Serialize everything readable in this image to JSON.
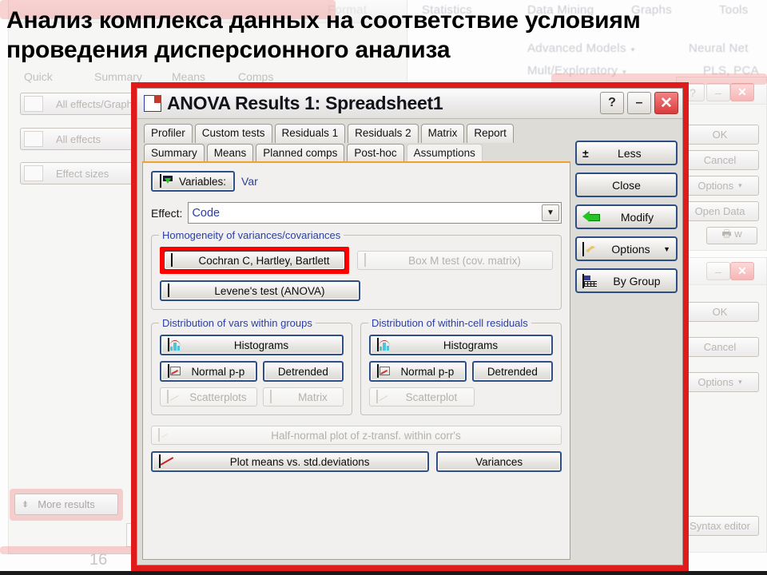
{
  "slide": {
    "title_line1": "Анализ комплекса данных на соответствие условиям",
    "title_line2": "проведения дисперсионного анализа",
    "page_number": "16"
  },
  "background": {
    "ribbon_menus": [
      "Format",
      "Statistics",
      "Data Mining",
      "Graphs",
      "Tools"
    ],
    "ribbon_items": [
      "Advanced Models",
      "Neural Net",
      "Mult/Exploratory",
      "PLS, PCA"
    ],
    "left_window": {
      "tabs": [
        "Quick",
        "Summary",
        "Means",
        "Comps"
      ],
      "buttons": [
        "All effects/Graphs",
        "All effects",
        "Effect sizes"
      ],
      "more_results": "More results"
    },
    "right_window_top": {
      "buttons": [
        "OK",
        "Cancel",
        "Options",
        "Open Data"
      ]
    },
    "right_window_bottom": {
      "buttons": [
        "OK",
        "Cancel",
        "Options",
        "Syntax editor"
      ]
    }
  },
  "dialog": {
    "title": "ANOVA Results 1: Spreadsheet1",
    "caption_buttons": {
      "help": "?",
      "minimize": "–",
      "close": "✕"
    },
    "tabs_row1": [
      "Profiler",
      "Custom tests",
      "Residuals 1",
      "Residuals 2",
      "Matrix",
      "Report"
    ],
    "tabs_row2": [
      "Summary",
      "Means",
      "Planned comps",
      "Post-hoc",
      "Assumptions"
    ],
    "active_tab": "Assumptions",
    "variables": {
      "button_label": "Variables:",
      "value": "Var"
    },
    "effect": {
      "label": "Effect:",
      "value": "Code",
      "arrow": "▼"
    },
    "homogeneity": {
      "title": "Homogeneity of variances/covariances",
      "cochran": "Cochran C, Hartley, Bartlett",
      "box_m": "Box M test (cov. matrix)",
      "levene": "Levene's test (ANOVA)",
      "highlight_color": "#ff0000"
    },
    "vars_within_groups": {
      "title": "Distribution of vars within groups",
      "histograms": "Histograms",
      "normal_pp": "Normal p-p",
      "detrended": "Detrended",
      "scatterplots": "Scatterplots",
      "matrix": "Matrix"
    },
    "within_cell_residuals": {
      "title": "Distribution of within-cell residuals",
      "histograms": "Histograms",
      "normal_pp": "Normal p-p",
      "detrended": "Detrended",
      "scatterplot": "Scatterplot"
    },
    "bottom": {
      "half_normal": "Half-normal plot of z-transf. within corr's",
      "plot_means": "Plot means vs. std.deviations",
      "variances": "Variances"
    },
    "side_buttons": {
      "less": "Less",
      "less_icon_glyph": "±",
      "close": "Close",
      "modify": "Modify",
      "options": "Options",
      "options_caret": "▼",
      "by_group": "By Group"
    }
  }
}
